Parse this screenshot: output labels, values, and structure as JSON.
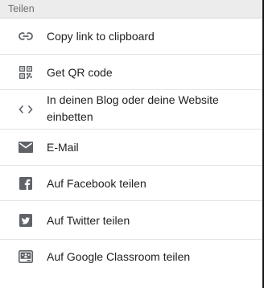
{
  "panel": {
    "title": "Teilen"
  },
  "items": [
    {
      "icon": "link-icon",
      "label": "Copy link to clipboard"
    },
    {
      "icon": "qr-code-icon",
      "label": "Get QR code"
    },
    {
      "icon": "code-icon",
      "label": "In deinen Blog oder deine Website einbetten"
    },
    {
      "icon": "email-icon",
      "label": "E-Mail"
    },
    {
      "icon": "facebook-icon",
      "label": "Auf Facebook teilen"
    },
    {
      "icon": "twitter-icon",
      "label": "Auf Twitter teilen"
    },
    {
      "icon": "google-classroom-icon",
      "label": "Auf Google Classroom teilen"
    }
  ],
  "colors": {
    "header_background": "#ececec",
    "icon": "#5f6368",
    "text": "#212121"
  }
}
